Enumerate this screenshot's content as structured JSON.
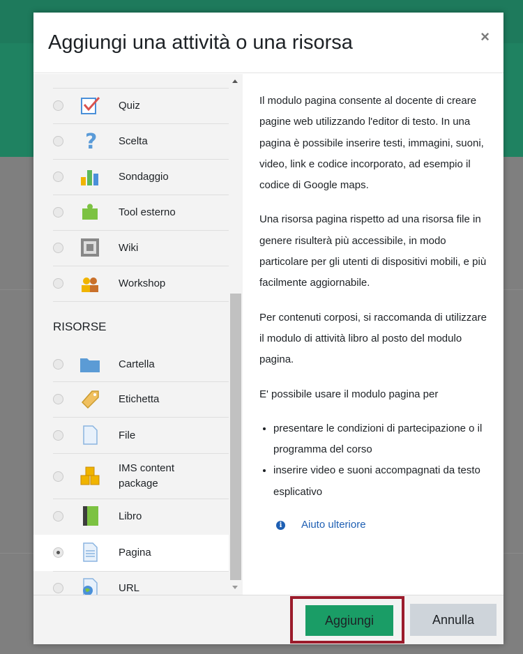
{
  "dialog": {
    "title": "Aggiungi una attività o una risorsa",
    "close_symbol": "×"
  },
  "options": [
    {
      "label": "Quiz",
      "icon": "quiz-icon",
      "selected": false
    },
    {
      "label": "Scelta",
      "icon": "choice-icon",
      "selected": false
    },
    {
      "label": "Sondaggio",
      "icon": "survey-icon",
      "selected": false
    },
    {
      "label": "Tool esterno",
      "icon": "external-tool-icon",
      "selected": false
    },
    {
      "label": "Wiki",
      "icon": "wiki-icon",
      "selected": false
    },
    {
      "label": "Workshop",
      "icon": "workshop-icon",
      "selected": false
    }
  ],
  "resources_heading": "RISORSE",
  "resources": [
    {
      "label": "Cartella",
      "icon": "folder-icon",
      "selected": false
    },
    {
      "label": "Etichetta",
      "icon": "label-icon",
      "selected": false
    },
    {
      "label": "File",
      "icon": "file-icon",
      "selected": false
    },
    {
      "label": "IMS content",
      "label2": "package",
      "icon": "ims-package-icon",
      "selected": false
    },
    {
      "label": "Libro",
      "icon": "book-icon",
      "selected": false
    },
    {
      "label": "Pagina",
      "icon": "page-icon",
      "selected": true
    },
    {
      "label": "URL",
      "icon": "url-icon",
      "selected": false
    }
  ],
  "help": {
    "p1": "Il modulo pagina consente al docente di creare pagine web utilizzando l'editor di testo. In una pagina è possibile inserire testi, immagini, suoni, video, link e codice incorporato, ad esempio il codice di Google maps.",
    "p2": "Una risorsa pagina rispetto ad una risorsa file in genere risulterà più accessibile, in modo particolare per gli utenti di dispositivi mobili, e più facilmente aggiornabile.",
    "p3": "Per contenuti corposi, si raccomanda di utilizzare il modulo di attività libro al posto del modulo pagina.",
    "p4": "E' possibile usare il modulo pagina per",
    "bullets": [
      "presentare le condizioni di partecipazione o il programma del corso",
      "inserire video e suoni accompagnati da testo esplicativo"
    ],
    "more_help": "Aiuto ulteriore",
    "info_symbol": "i"
  },
  "footer": {
    "add_label": "Aggiungi",
    "cancel_label": "Annulla"
  },
  "colors": {
    "primary": "#1a9d66",
    "highlight": "#9b1b2b",
    "link": "#1e5fb3"
  }
}
